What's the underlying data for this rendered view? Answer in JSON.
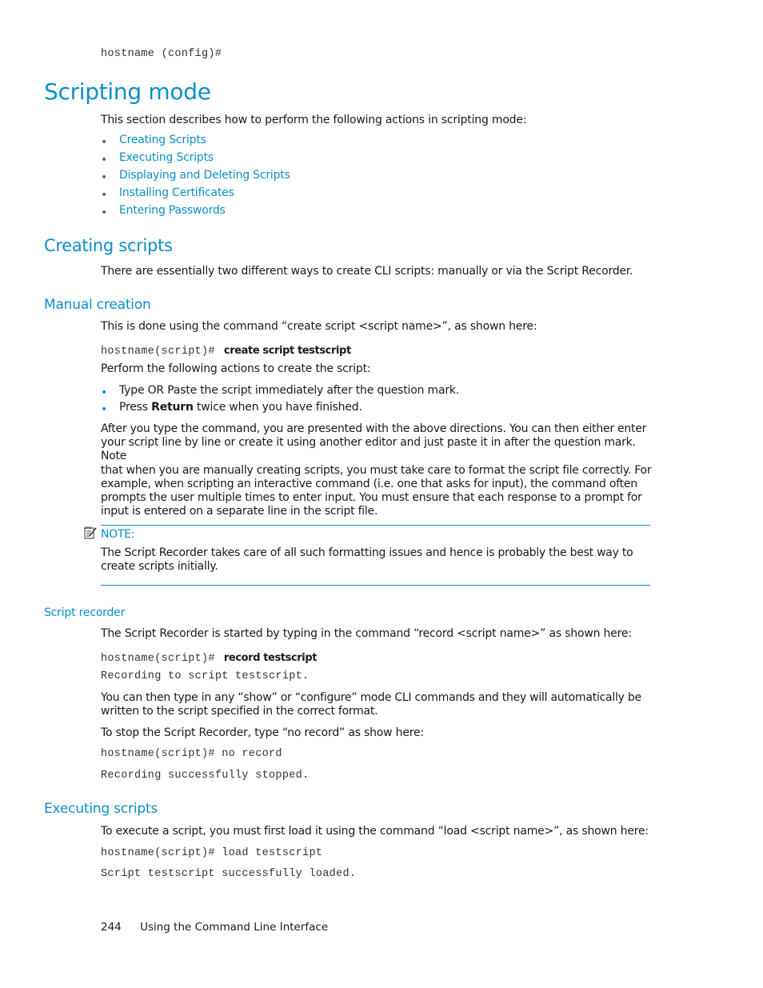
{
  "top_code": "hostname (config)#",
  "title": "Scripting mode",
  "intro": "This section describes how to perform the following actions in scripting mode:",
  "toc_links": [
    "Creating Scripts",
    "Executing Scripts",
    "Displaying and Deleting Scripts",
    "Installing Certificates",
    "Entering Passwords"
  ],
  "creating": {
    "heading": "Creating scripts",
    "intro": "There are essentially two different ways to create CLI scripts:  manually or via the Script Recorder."
  },
  "manual": {
    "heading": "Manual creation",
    "intro": "This is done using the command “create script <script name>”, as shown here:",
    "prompt": "hostname(script)#",
    "command": "create script testscript",
    "steps_intro": "Perform the following actions to create the script:",
    "steps": [
      {
        "text": "Type OR Paste the script immediately after the question mark."
      },
      {
        "pre": "Press ",
        "bold": "Return",
        "post": " twice when you have finished."
      }
    ],
    "para_lines": [
      "After you type the command, you are presented with the above directions.  You can then either enter",
      "your script line by line or create it using another editor and just paste it in after the question mark.  Note",
      "that when you are manually creating scripts, you must take care to format the script file correctly.  For",
      "example, when scripting an interactive command (i.e.  one that asks for input), the command often",
      "prompts the user multiple times to enter input.  You must ensure that each response to a prompt for",
      "input is entered on a separate line in the script file."
    ]
  },
  "note": {
    "label": "NOTE:",
    "lines": [
      "The Script Recorder takes care of all such formatting issues and hence is probably the best way to",
      "create scripts initially."
    ]
  },
  "recorder": {
    "heading": "Script recorder",
    "intro": "The Script Recorder is started by typing in the command “record <script name>” as shown here:",
    "prompt": "hostname(script)#",
    "command": "record testscript",
    "output1": "Recording to script testscript.",
    "para_lines": [
      "You can then type in any “show” or “configure” mode CLI commands and they will automatically be",
      "written to the script specified in the correct format."
    ],
    "stop_intro": "To stop the Script Recorder, type “no record” as show here:",
    "stop_cmd": "hostname(script)# no record",
    "stop_output": "Recording successfully stopped."
  },
  "executing": {
    "heading": "Executing scripts",
    "intro": "To execute a script, you must first load it using the command “load <script name>”, as shown here:",
    "cmd": "hostname(script)# load testscript",
    "output": "Script testscript successfully loaded."
  },
  "footer": {
    "page_number": "244",
    "chapter": "Using the Command Line Interface"
  }
}
